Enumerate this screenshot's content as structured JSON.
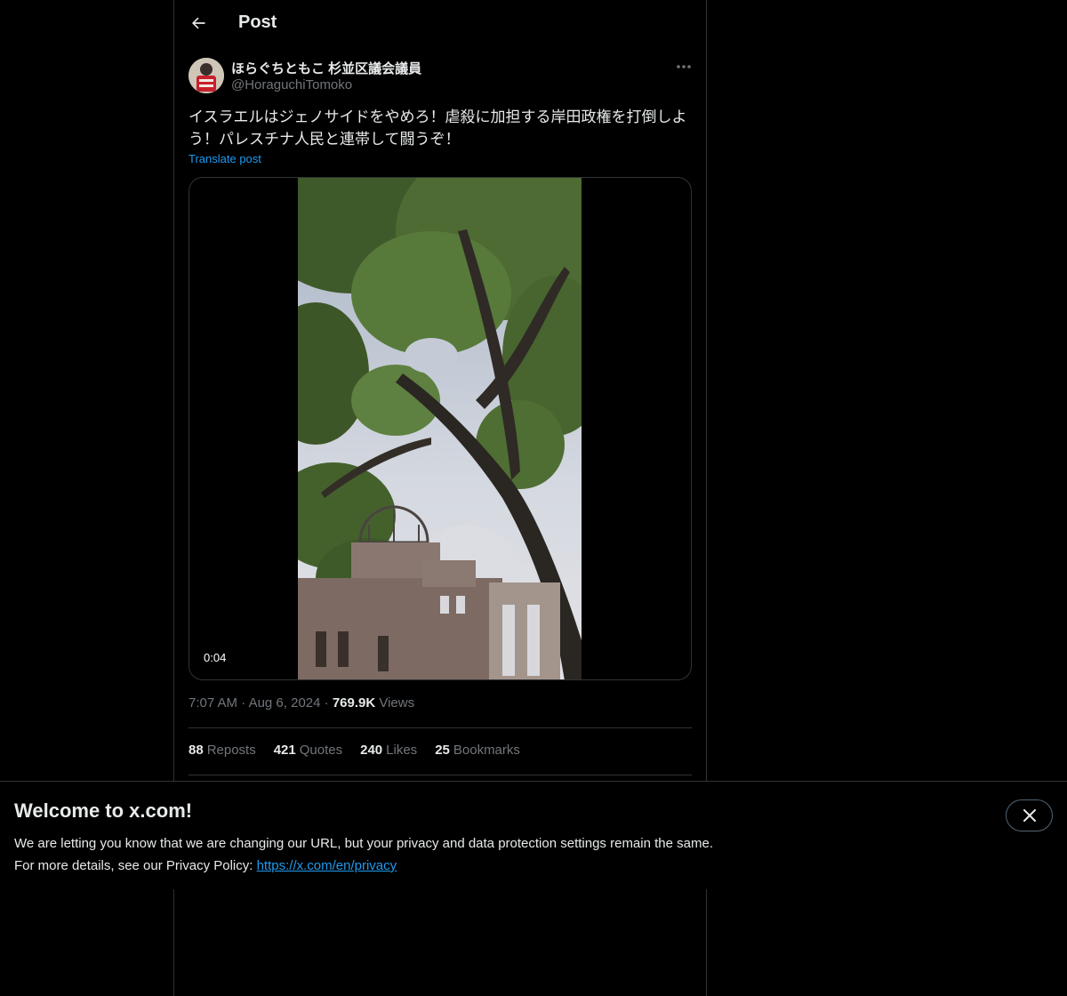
{
  "header": {
    "title": "Post"
  },
  "post": {
    "author": {
      "display_name": "ほらぐちともこ 杉並区議会議員",
      "handle": "@HoraguchiTomoko"
    },
    "text": "イスラエルはジェノサイドをやめろ！虐殺に加担する岸田政権を打倒しよう！パレスチナ人民と連帯して闘うぞ！",
    "translate_label": "Translate post",
    "video": {
      "duration": "0:04"
    },
    "time": "7:07 AM",
    "date": "Aug 6, 2024",
    "views_count": "769.9K",
    "views_label": "Views",
    "stats": {
      "reposts": {
        "count": "88",
        "label": "Reposts"
      },
      "quotes": {
        "count": "421",
        "label": "Quotes"
      },
      "likes": {
        "count": "240",
        "label": "Likes"
      },
      "bookmarks": {
        "count": "25",
        "label": "Bookmarks"
      }
    }
  },
  "banner": {
    "title": "Welcome to x.com!",
    "line1": "We are letting you know that we are changing our URL, but your privacy and data protection settings remain the same.",
    "line2_prefix": "For more details, see our Privacy Policy: ",
    "link": "https://x.com/en/privacy"
  },
  "icons": {
    "back": "arrow-left-icon",
    "more": "more-horizontal-icon",
    "close": "close-icon"
  },
  "colors": {
    "background": "#000000",
    "text": "#e7e9ea",
    "secondary": "#71767b",
    "accent": "#1d9bf0",
    "border": "#2f3336"
  }
}
